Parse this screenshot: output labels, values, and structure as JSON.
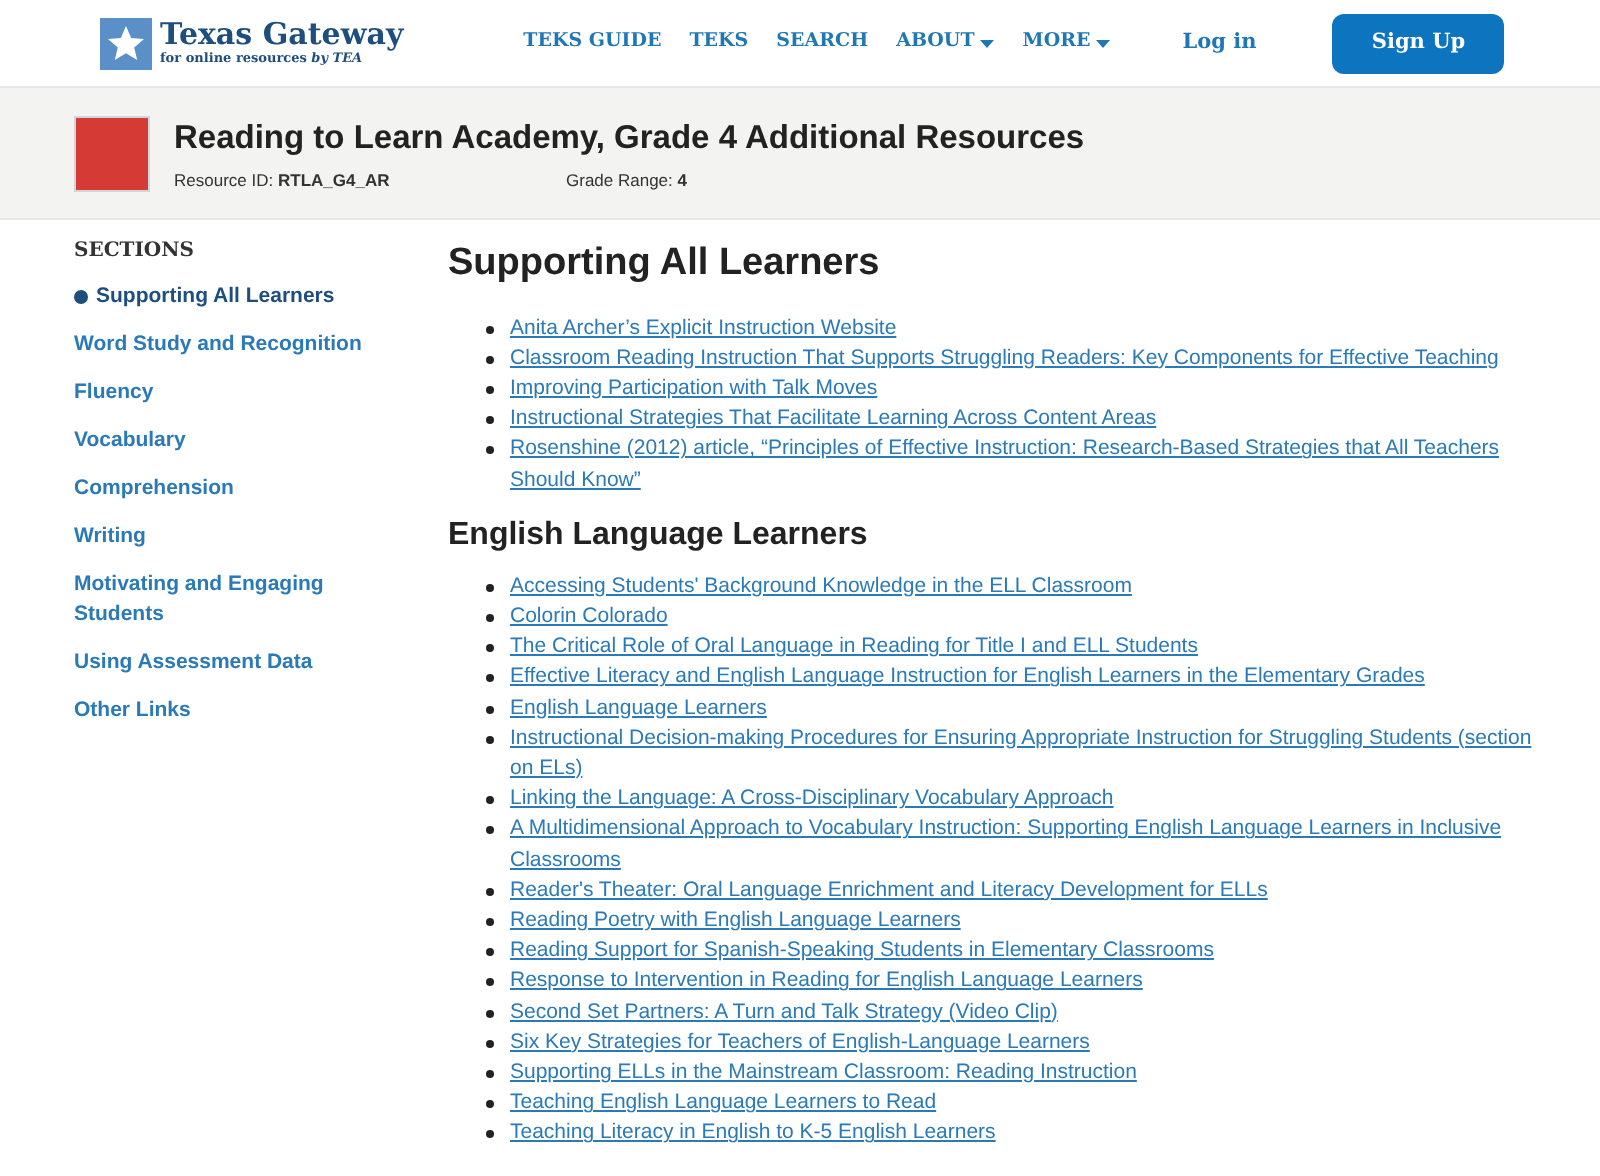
{
  "header": {
    "logo": {
      "title": "Texas Gateway",
      "subtitle": "for online resources *by TEA*"
    },
    "nav": [
      {
        "label": "TEKS GUIDE",
        "dropdown": false
      },
      {
        "label": "TEKS",
        "dropdown": false
      },
      {
        "label": "SEARCH",
        "dropdown": false
      },
      {
        "label": "ABOUT",
        "dropdown": true
      },
      {
        "label": "MORE",
        "dropdown": true
      }
    ],
    "login": "Log in",
    "signup": "Sign Up"
  },
  "resource": {
    "title": "Reading to Learn Academy, Grade 4 Additional Resources",
    "id_label": "Resource ID:",
    "id": "RTLA_G4_AR",
    "grade_label": "Grade Range:",
    "grade": "4"
  },
  "sidebar": {
    "heading": "SECTIONS",
    "items": [
      {
        "label": "Supporting All Learners",
        "selected": true
      },
      {
        "label": "Word Study and Recognition",
        "selected": false
      },
      {
        "label": "Fluency",
        "selected": false
      },
      {
        "label": "Vocabulary",
        "selected": false
      },
      {
        "label": "Comprehension",
        "selected": false
      },
      {
        "label": "Writing",
        "selected": false
      },
      {
        "label": "Motivating and Engaging Students",
        "selected": false
      },
      {
        "label": "Using Assessment Data",
        "selected": false
      },
      {
        "label": "Other Links",
        "selected": false
      }
    ]
  },
  "sections": [
    {
      "heading": "Supporting All Learners",
      "links": [
        "Anita Archer’s Explicit Instruction Website",
        "Classroom Reading Instruction That Supports Struggling Readers:  Key Components for Effective Teaching",
        "Improving Participation with Talk Moves",
        "Instructional Strategies That Facilitate Learning Across Content Areas",
        "Rosenshine (2012) article, “Principles of Effective Instruction: Research-Based Strategies that All Teachers Should Know”"
      ]
    },
    {
      "heading": "English Language Learners",
      "links": [
        "Accessing Students' Background Knowledge in the ELL Classroom",
        "Colorin Colorado",
        "The Critical Role of Oral Language in Reading for Title I and ELL Students",
        "Effective Literacy and English Language Instruction for English Learners in the Elementary Grades",
        "English Language Learners",
        "Instructional Decision-making Procedures for Ensuring Appropriate Instruction for Struggling Students (section on ELs)",
        "Linking the Language: A Cross-Disciplinary Vocabulary Approach",
        "A Multidimensional Approach to Vocabulary Instruction: Supporting English Language Learners in Inclusive Classrooms",
        "Reader's Theater: Oral Language Enrichment and Literacy Development for ELLs",
        "Reading Poetry with English Language Learners",
        "Reading Support for Spanish-Speaking Students in Elementary Classrooms",
        "Response to Intervention in Reading for English Language Learners",
        "Second Set Partners: A Turn and Talk Strategy (Video Clip)",
        "Six Key Strategies for Teachers of English-Language Learners",
        "Supporting ELLs in the Mainstream Classroom: Reading Instruction",
        "Teaching English Language Learners to Read",
        "Teaching Literacy in English to K-5 English Learners"
      ]
    }
  ]
}
